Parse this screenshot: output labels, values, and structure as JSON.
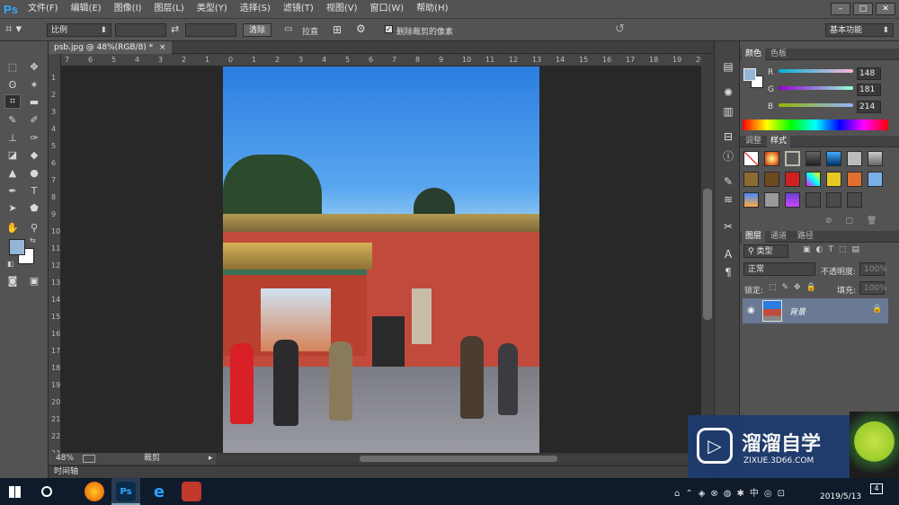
{
  "app": {
    "logo": "Ps",
    "menus": [
      "文件(F)",
      "编辑(E)",
      "图像(I)",
      "图层(L)",
      "类型(Y)",
      "选择(S)",
      "滤镜(T)",
      "视图(V)",
      "窗口(W)",
      "帮助(H)"
    ],
    "window_buttons": [
      "–",
      "□",
      "✕"
    ]
  },
  "options": {
    "ratio_label": "比例",
    "clear_button": "清除",
    "straighten_label": "拉直",
    "delete_cropped_label": "删除裁剪的像素",
    "workspace": "基本功能"
  },
  "document": {
    "tab_title": "psb.jpg @ 48%(RGB/8) *",
    "tab_close": "×",
    "zoom": "48%",
    "status_tool": "裁剪"
  },
  "ruler": {
    "h_labels": [
      "7",
      "6",
      "5",
      "4",
      "3",
      "2",
      "1",
      "0",
      "1",
      "2",
      "3",
      "4",
      "5",
      "6",
      "7",
      "8",
      "9",
      "10",
      "11",
      "12",
      "13",
      "14",
      "15",
      "16",
      "17",
      "18",
      "19",
      "20"
    ],
    "v_labels": [
      "1",
      "2",
      "3",
      "4",
      "5",
      "6",
      "7",
      "8",
      "9",
      "10",
      "11",
      "12",
      "13",
      "14",
      "15",
      "16",
      "17",
      "18",
      "19",
      "20",
      "21",
      "22",
      "23"
    ]
  },
  "timeline": {
    "label": "时间轴"
  },
  "color_panel": {
    "tabs": [
      "颜色",
      "色板"
    ],
    "r_label": "R",
    "g_label": "G",
    "b_label": "B",
    "r": "148",
    "g": "181",
    "b": "214",
    "fg_color": "#94b5d6"
  },
  "styles_panel": {
    "tabs": [
      "调整",
      "样式"
    ]
  },
  "layers_panel": {
    "tabs": [
      "图层",
      "通道",
      "路径"
    ],
    "filter_label": "类型",
    "blend_mode": "正常",
    "opacity_label": "不透明度:",
    "opacity_value": "100%",
    "lock_label": "锁定:",
    "fill_label": "填充:",
    "fill_value": "100%",
    "layer_name": "背景"
  },
  "watermark": {
    "brand": "溜溜自学",
    "url": "ZIXUE.3D66.COM"
  },
  "taskbar": {
    "time": "2019/5/13",
    "notification": "4"
  },
  "colors": {
    "ps_blue": "#31a8ff",
    "panel_bg": "#535353",
    "canvas_bg": "#282828",
    "wall_red": "#c24a3c"
  }
}
